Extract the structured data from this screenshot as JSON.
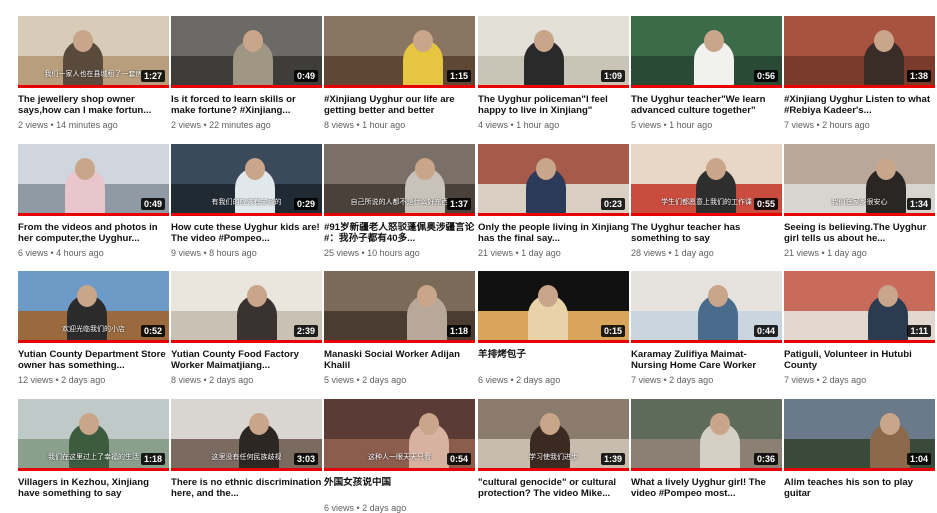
{
  "colors": {
    "progress": "#e60000",
    "title": "#111111",
    "meta": "#606060"
  },
  "videos": [
    {
      "title": "The jewellery shop owner says,how can I make fortun...",
      "duration": "1:27",
      "views": "2 views",
      "age": "14 minutes ago",
      "caption": "我们一家人也在县城租了一套房",
      "palette": [
        "#d8cbb8",
        "#b89e7c",
        "#5a4a3c"
      ],
      "progress": 1.0
    },
    {
      "title": "Is it forced to learn skills or make fortune? #Xinjiang...",
      "duration": "0:49",
      "views": "2 views",
      "age": "22 minutes ago",
      "caption": "",
      "palette": [
        "#6c6a66",
        "#3f3d3a",
        "#a09684"
      ],
      "progress": 1.0
    },
    {
      "title": "#Xinjiang Uyghur our life are getting better and better",
      "duration": "1:15",
      "views": "8 views",
      "age": "1 hour ago",
      "caption": "",
      "palette": [
        "#8a7562",
        "#5e4735",
        "#e6c640"
      ],
      "progress": 1.0
    },
    {
      "title": "The Uyghur policeman\"I feel happy to live in Xinjiang\"",
      "duration": "1:09",
      "views": "4 views",
      "age": "1 hour ago",
      "caption": "",
      "palette": [
        "#e3e0d8",
        "#c9c4b6",
        "#2a2a2a"
      ],
      "progress": 1.0
    },
    {
      "title": "The Uyghur teacher\"We learn advanced culture together\"",
      "duration": "0:56",
      "views": "5 views",
      "age": "1 hour ago",
      "caption": "",
      "palette": [
        "#3c6b4a",
        "#2b4a35",
        "#f1f1ef"
      ],
      "progress": 1.0
    },
    {
      "title": "#Xinjiang Uyghur Listen to what #Rebiya Kadeer's...",
      "duration": "1:38",
      "views": "7 views",
      "age": "2 hours ago",
      "caption": "",
      "palette": [
        "#a8533f",
        "#7a3a2c",
        "#3a2c26"
      ],
      "progress": 1.0
    },
    {
      "title": "From the videos and photos in her computer,the Uyghur...",
      "duration": "0:49",
      "views": "6 views",
      "age": "4 hours ago",
      "caption": "",
      "palette": [
        "#cfd6dd",
        "#8f9aa5",
        "#e8c6cc"
      ],
      "progress": 1.0
    },
    {
      "title": "How cute these Uyghur kids are! The video #Pompeo...",
      "duration": "0:29",
      "views": "9 views",
      "age": "8 hours ago",
      "caption": "有我们的应该有关系的",
      "palette": [
        "#3a4a5a",
        "#1f2a33",
        "#e0e8ec"
      ],
      "progress": 1.0
    },
    {
      "title": "#91岁新疆老人怒驳蓬佩奥涉疆言论#：我孙子都有40多...",
      "duration": "1:37",
      "views": "25 views",
      "age": "10 hours ago",
      "caption": "自己所说的人都不是什么好东西",
      "palette": [
        "#7b7068",
        "#4a413b",
        "#c8c2bb"
      ],
      "progress": 1.0
    },
    {
      "title": "Only the people living in Xinjiang has the final say...",
      "duration": "0:23",
      "views": "21 views",
      "age": "1 day ago",
      "caption": "",
      "palette": [
        "#a65a49",
        "#d9cfc2",
        "#2c3a5a"
      ],
      "progress": 1.0
    },
    {
      "title": "The Uyghur teacher has something to say",
      "duration": "0:55",
      "views": "28 views",
      "age": "1 day ago",
      "caption": "学生们都愿意上我们的工作课",
      "palette": [
        "#e9d7c6",
        "#c94c3e",
        "#2e2e2e"
      ],
      "progress": 1.0
    },
    {
      "title": "Seeing is believing.The Uyghur girl tells us about he...",
      "duration": "1:34",
      "views": "21 views",
      "age": "1 day ago",
      "caption": "我们在家乡很安心",
      "palette": [
        "#b9a89a",
        "#d8d4cf",
        "#2a2624"
      ],
      "progress": 1.0
    },
    {
      "title": "Yutian County Department Store owner has something...",
      "duration": "0:52",
      "views": "12 views",
      "age": "2 days ago",
      "caption": "欢迎光临我们的小店",
      "palette": [
        "#6d9ac7",
        "#9a6a3e",
        "#2b2b2b"
      ],
      "progress": 1.0
    },
    {
      "title": "Yutian County Food Factory Worker Maimatjiang...",
      "duration": "2:39",
      "views": "8 views",
      "age": "2 days ago",
      "caption": "",
      "palette": [
        "#eae6de",
        "#c9c2b4",
        "#3a3230"
      ],
      "progress": 1.0
    },
    {
      "title": "Manaski Social Worker Adijan Khalil",
      "duration": "1:18",
      "views": "5 views",
      "age": "2 days ago",
      "caption": "",
      "palette": [
        "#7c6a58",
        "#4b3c31",
        "#b7a89a"
      ],
      "progress": 1.0
    },
    {
      "title": "羊排烤包子",
      "duration": "0:15",
      "views": "6 views",
      "age": "2 days ago",
      "caption": "",
      "palette": [
        "#111111",
        "#d9a55a",
        "#e8d3a8"
      ],
      "progress": 1.0
    },
    {
      "title": "Karamay Zulifiya Maimat-Nursing Home Care Worker",
      "duration": "0:44",
      "views": "7 views",
      "age": "2 days ago",
      "caption": "",
      "palette": [
        "#e6e3de",
        "#c9d6e0",
        "#4a6c8c"
      ],
      "progress": 1.0
    },
    {
      "title": "Patiguli, Volunteer in Hutubi County",
      "duration": "1:11",
      "views": "7 views",
      "age": "2 days ago",
      "caption": "",
      "palette": [
        "#c96b5a",
        "#e3d8cf",
        "#2c3b4f"
      ],
      "progress": 1.0
    },
    {
      "title": "Villagers in Kezhou, Xinjiang have something to say",
      "duration": "1:18",
      "views": "",
      "age": "",
      "caption": "我们在这里过上了幸福的生活",
      "palette": [
        "#bfc9c8",
        "#8aa08c",
        "#3d5b3f"
      ],
      "progress": 1.0
    },
    {
      "title": "There is no ethnic discrimination here, and the...",
      "duration": "3:03",
      "views": "",
      "age": "",
      "caption": "这里没有任何民族歧视",
      "palette": [
        "#d9d6d2",
        "#7a6a60",
        "#2d2724"
      ],
      "progress": 1.0
    },
    {
      "title": "外国女孩说中国",
      "duration": "0:54",
      "views": "6 views",
      "age": "2 days ago",
      "caption": "这种人一眼天天只看",
      "palette": [
        "#5a3b36",
        "#8c5c4c",
        "#d8b2a0"
      ],
      "progress": 1.0
    },
    {
      "title": "\"cultural genocide\" or cultural protection? The video Mike...",
      "duration": "1:39",
      "views": "",
      "age": "",
      "caption": "学习使我们进步",
      "palette": [
        "#8a7b6c",
        "#c8bcae",
        "#3a2a22"
      ],
      "progress": 1.0
    },
    {
      "title": "What a lively Uyghur girl! The video #Pompeo most...",
      "duration": "0:36",
      "views": "",
      "age": "",
      "caption": "",
      "palette": [
        "#5e6a5a",
        "#8c8074",
        "#d6cfc6"
      ],
      "progress": 1.0
    },
    {
      "title": "Alim teaches his son to play guitar",
      "duration": "1:04",
      "views": "",
      "age": "",
      "caption": "",
      "palette": [
        "#6a7a8a",
        "#3a4a3a",
        "#8a6a4a"
      ],
      "progress": 1.0
    }
  ]
}
